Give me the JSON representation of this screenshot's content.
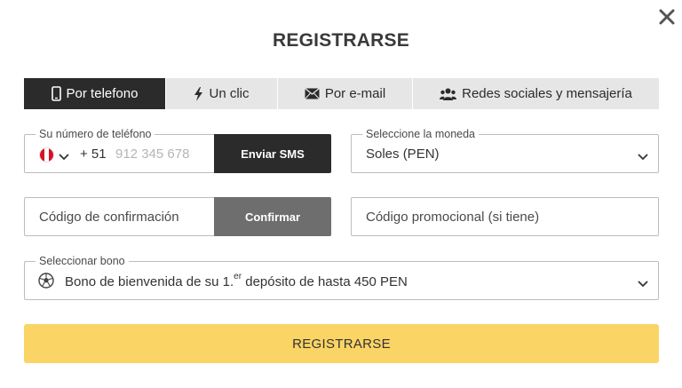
{
  "dialog": {
    "title": "REGISTRARSE",
    "close_icon": "close-icon"
  },
  "tabs": [
    {
      "label": "Por telefono",
      "icon": "phone-icon",
      "active": true
    },
    {
      "label": "Un clic",
      "icon": "lightning-icon",
      "active": false
    },
    {
      "label": "Por e-mail",
      "icon": "envelope-icon",
      "active": false
    },
    {
      "label": "Redes sociales y mensajería",
      "icon": "users-icon",
      "active": false
    }
  ],
  "phone": {
    "label": "Su número de teléfono",
    "country_flag": "peru-flag-icon",
    "dial_code": "+ 51",
    "placeholder": "912 345 678",
    "send_button": "Enviar SMS"
  },
  "currency": {
    "label": "Seleccione la moneda",
    "selected": "Soles (PEN)"
  },
  "confirmation": {
    "placeholder": "Código de confirmación",
    "button": "Confirmar"
  },
  "promo": {
    "placeholder": "Código promocional (si tiene)"
  },
  "bonus": {
    "label": "Seleccionar bono",
    "text_before": "Bono de bienvenida de su 1.",
    "superscript": "er",
    "text_after": " depósito de hasta 450 PEN",
    "icon": "soccer-ball-icon"
  },
  "submit": {
    "label": "REGISTRARSE"
  },
  "colors": {
    "accent": "#fad465",
    "dark": "#2b2b2b",
    "tab_bg": "#e6e6e6",
    "disabled_button": "#6e6e6e"
  }
}
